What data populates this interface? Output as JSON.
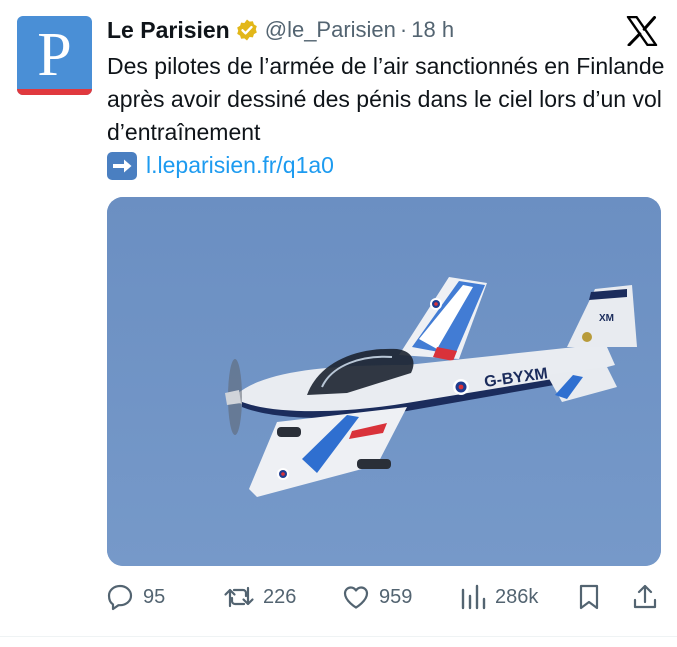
{
  "account": {
    "name": "Le Parisien",
    "handle": "@le_Parisien",
    "separator": "·",
    "time": "18 h",
    "avatar_letter": "P",
    "avatar_color": "#4a8fd6",
    "verified_icon": "gold-verified-badge"
  },
  "tweet": {
    "text": "Des pilotes de l’armée de l’air sanctionnés en Finlande après avoir dessiné des pénis dans le ciel lors d’un vol d’entraînement",
    "link_emoji": "right-arrow-emoji",
    "link": "l.leparisien.fr/q1a0"
  },
  "media": {
    "aircraft_registration": "G-BYXM",
    "tail_code": "XM",
    "sky_color": "#6f93c4"
  },
  "actions": {
    "replies": "95",
    "reposts": "226",
    "likes": "959",
    "views": "286k"
  },
  "colors": {
    "link": "#1d9bf0",
    "muted": "#536471"
  }
}
